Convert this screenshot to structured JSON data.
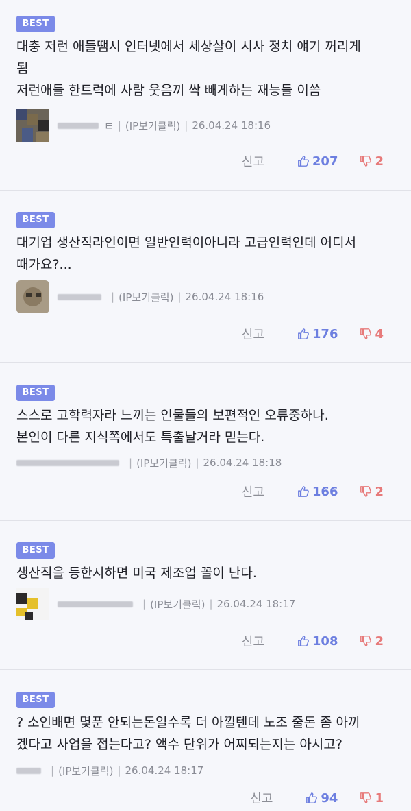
{
  "comments": [
    {
      "badge": "BEST",
      "text": "대충 저런 애들땜시 인터넷에서 세상살이 시사 정치 얘기 꺼리게\n됨\n저런애들 한트럭에 사람 웃음끼 싹 빼게하는 재능들 이씀",
      "user_suffix": "ㅌ",
      "ip": "(IP보기클릭)",
      "date": "26.04.24 18:16",
      "report": "신고",
      "up": "207",
      "down": "2"
    },
    {
      "badge": "BEST",
      "text": "대기업 생산직라인이면 일반인력이아니라 고급인력인데 어디서\n때가요?...",
      "user_suffix": "",
      "ip": "(IP보기클릭)",
      "date": "26.04.24 18:16",
      "report": "신고",
      "up": "176",
      "down": "4"
    },
    {
      "badge": "BEST",
      "text": "스스로 고학력자라 느끼는 인물들의 보편적인 오류중하나.\n본인이 다른 지식쪽에서도 특출날거라 믿는다.",
      "user_suffix": "",
      "ip": "(IP보기클릭)",
      "date": "26.04.24 18:18",
      "report": "신고",
      "up": "166",
      "down": "2"
    },
    {
      "badge": "BEST",
      "text": "생산직을 등한시하면 미국 제조업 꼴이 난다.",
      "user_suffix": "",
      "ip": "(IP보기클릭)",
      "date": "26.04.24 18:17",
      "report": "신고",
      "up": "108",
      "down": "2"
    },
    {
      "badge": "BEST",
      "text": "? 소인배면 몇푼 안되는돈일수록 더 아낄텐데 노조 줄돈 좀 아끼\n겠다고 사업을 접는다고? 액수 단위가 어찌되는지는 아시고?",
      "user_suffix": "",
      "ip": "(IP보기클릭)",
      "date": "26.04.24 18:17",
      "report": "신고",
      "up": "94",
      "down": "1"
    }
  ]
}
